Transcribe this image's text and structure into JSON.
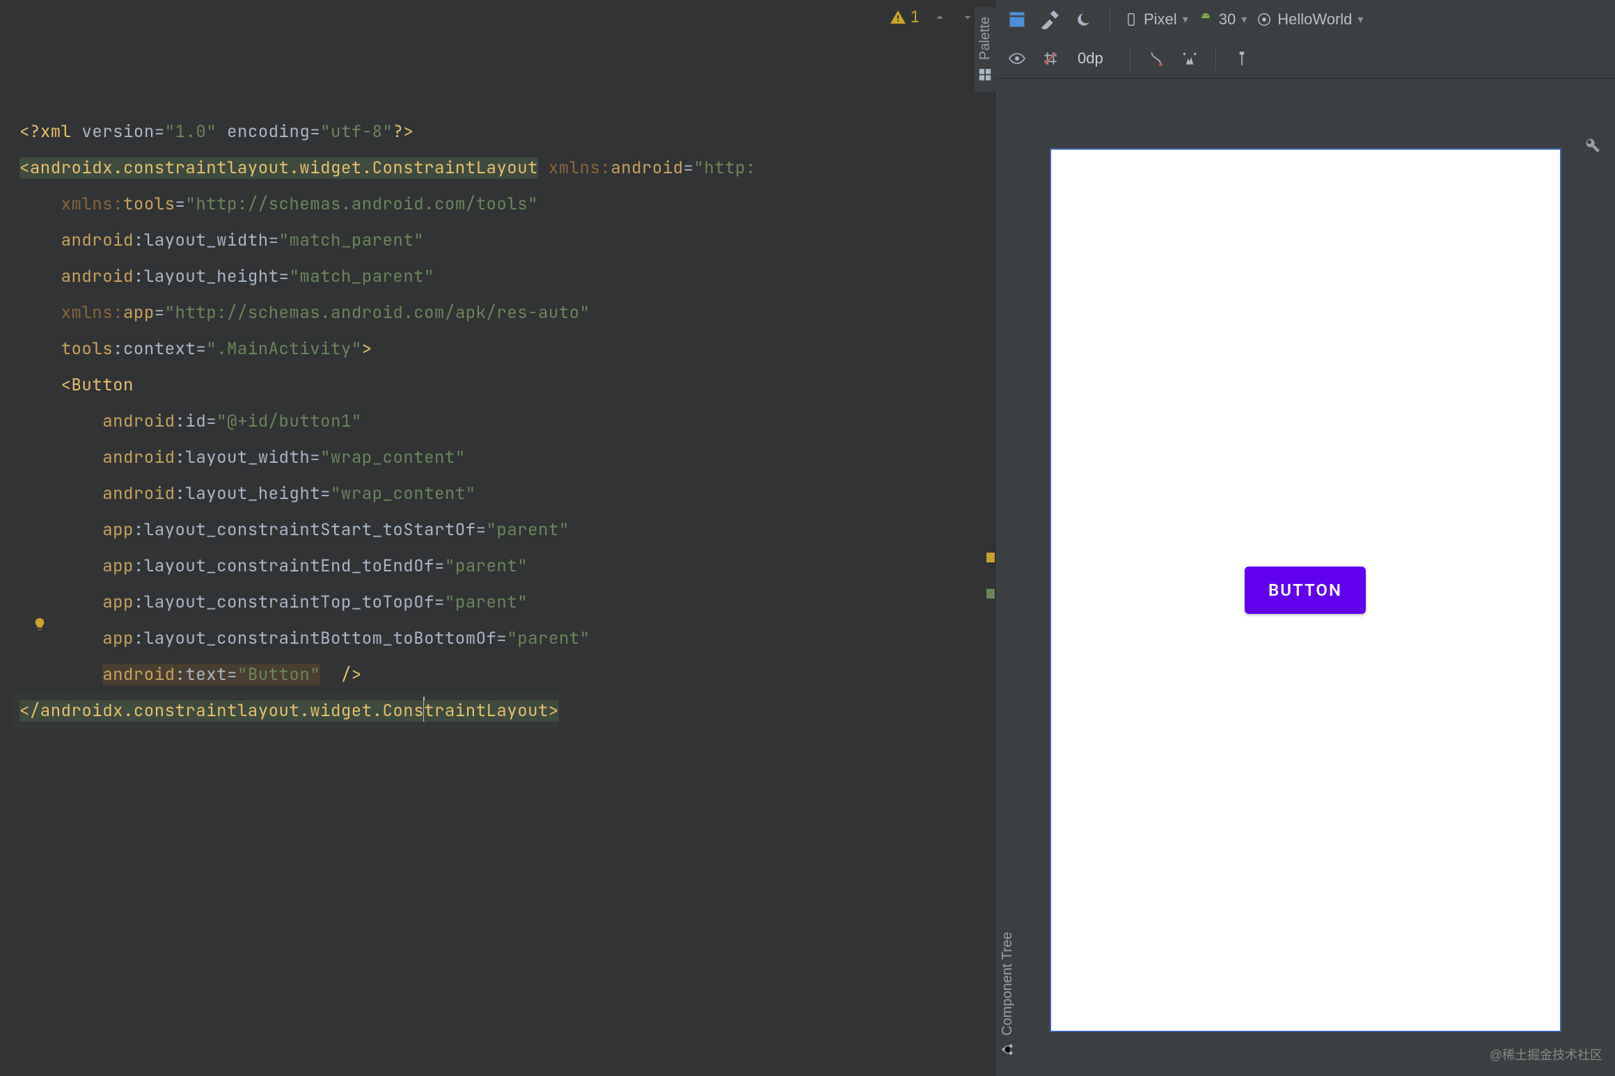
{
  "editor": {
    "warning_count": "1",
    "lines": [
      [
        {
          "cls": "pi",
          "t": "<?"
        },
        {
          "cls": "pi",
          "t": "xml "
        },
        {
          "cls": "light",
          "t": "version"
        },
        {
          "cls": "eq",
          "t": "="
        },
        {
          "cls": "str",
          "t": "\"1.0\" "
        },
        {
          "cls": "light",
          "t": "encoding"
        },
        {
          "cls": "eq",
          "t": "="
        },
        {
          "cls": "str",
          "t": "\"utf-8\""
        },
        {
          "cls": "pi",
          "t": "?>"
        }
      ],
      [
        {
          "cls": "tag sel-tag",
          "t": "<androidx.constraintlayout.widget.ConstraintLayout"
        },
        {
          "cls": "light",
          "t": " "
        },
        {
          "cls": "attrns",
          "t": "xmlns:"
        },
        {
          "cls": "attrns2",
          "t": "android"
        },
        {
          "cls": "eq",
          "t": "="
        },
        {
          "cls": "str",
          "t": "\"http:"
        }
      ],
      [
        {
          "cls": "light",
          "t": "    "
        },
        {
          "cls": "attrns",
          "t": "xmlns:"
        },
        {
          "cls": "attrns2",
          "t": "tools"
        },
        {
          "cls": "eq",
          "t": "="
        },
        {
          "cls": "str",
          "t": "\"http://schemas.android.com/tools\""
        }
      ],
      [
        {
          "cls": "light",
          "t": "    "
        },
        {
          "cls": "attrns2",
          "t": "android"
        },
        {
          "cls": "light",
          "t": ":"
        },
        {
          "cls": "light",
          "t": "layout_width"
        },
        {
          "cls": "eq",
          "t": "="
        },
        {
          "cls": "str",
          "t": "\"match_parent\""
        }
      ],
      [
        {
          "cls": "light",
          "t": "    "
        },
        {
          "cls": "attrns2",
          "t": "android"
        },
        {
          "cls": "light",
          "t": ":"
        },
        {
          "cls": "light",
          "t": "layout_height"
        },
        {
          "cls": "eq",
          "t": "="
        },
        {
          "cls": "str",
          "t": "\"match_parent\""
        }
      ],
      [
        {
          "cls": "light",
          "t": "    "
        },
        {
          "cls": "attrns",
          "t": "xmlns:"
        },
        {
          "cls": "attrns2",
          "t": "app"
        },
        {
          "cls": "eq",
          "t": "="
        },
        {
          "cls": "str",
          "t": "\"http://schemas.android.com/apk/res-auto\""
        }
      ],
      [
        {
          "cls": "light",
          "t": "    "
        },
        {
          "cls": "attrns2",
          "t": "tools"
        },
        {
          "cls": "light",
          "t": ":"
        },
        {
          "cls": "light",
          "t": "context"
        },
        {
          "cls": "eq",
          "t": "="
        },
        {
          "cls": "str",
          "t": "\".MainActivity\""
        },
        {
          "cls": "tag",
          "t": ">"
        }
      ],
      [
        {
          "cls": "light",
          "t": "    "
        },
        {
          "cls": "tag",
          "t": "<Button"
        }
      ],
      [
        {
          "cls": "light",
          "t": "        "
        },
        {
          "cls": "attrns2",
          "t": "android"
        },
        {
          "cls": "light",
          "t": ":"
        },
        {
          "cls": "light",
          "t": "id"
        },
        {
          "cls": "eq",
          "t": "="
        },
        {
          "cls": "str",
          "t": "\"@+id/button1\""
        }
      ],
      [
        {
          "cls": "light",
          "t": "        "
        },
        {
          "cls": "attrns2",
          "t": "android"
        },
        {
          "cls": "light",
          "t": ":"
        },
        {
          "cls": "light",
          "t": "layout_width"
        },
        {
          "cls": "eq",
          "t": "="
        },
        {
          "cls": "str",
          "t": "\"wrap_content\""
        }
      ],
      [
        {
          "cls": "light",
          "t": "        "
        },
        {
          "cls": "attrns2",
          "t": "android"
        },
        {
          "cls": "light",
          "t": ":"
        },
        {
          "cls": "light",
          "t": "layout_height"
        },
        {
          "cls": "eq",
          "t": "="
        },
        {
          "cls": "str",
          "t": "\"wrap_content\""
        }
      ],
      [
        {
          "cls": "light",
          "t": "        "
        },
        {
          "cls": "attrns2",
          "t": "app"
        },
        {
          "cls": "light",
          "t": ":"
        },
        {
          "cls": "light",
          "t": "layout_constraintStart_toStartOf"
        },
        {
          "cls": "eq",
          "t": "="
        },
        {
          "cls": "str",
          "t": "\"parent\""
        }
      ],
      [
        {
          "cls": "light",
          "t": "        "
        },
        {
          "cls": "attrns2",
          "t": "app"
        },
        {
          "cls": "light",
          "t": ":"
        },
        {
          "cls": "light",
          "t": "layout_constraintEnd_toEndOf"
        },
        {
          "cls": "eq",
          "t": "="
        },
        {
          "cls": "str",
          "t": "\"parent\""
        }
      ],
      [
        {
          "cls": "light",
          "t": "        "
        },
        {
          "cls": "attrns2",
          "t": "app"
        },
        {
          "cls": "light",
          "t": ":"
        },
        {
          "cls": "light",
          "t": "layout_constraintTop_toTopOf"
        },
        {
          "cls": "eq",
          "t": "="
        },
        {
          "cls": "str",
          "t": "\"parent\""
        }
      ],
      [
        {
          "cls": "light",
          "t": "        "
        },
        {
          "cls": "attrns2",
          "t": "app"
        },
        {
          "cls": "light",
          "t": ":"
        },
        {
          "cls": "light",
          "t": "layout_constraintBottom_toBottomOf"
        },
        {
          "cls": "eq",
          "t": "="
        },
        {
          "cls": "str",
          "t": "\"parent\""
        }
      ],
      [
        {
          "cls": "light",
          "t": "        "
        },
        {
          "cls": "attrns2 hl-attr",
          "t": "android"
        },
        {
          "cls": "light hl-attr",
          "t": ":"
        },
        {
          "cls": "light hl-attr",
          "t": "text"
        },
        {
          "cls": "eq hl-attr",
          "t": "="
        },
        {
          "cls": "str hl-attr",
          "t": "\"Button\""
        },
        {
          "cls": "light",
          "t": "  "
        },
        {
          "cls": "tag",
          "t": "/>"
        }
      ],
      [
        {
          "cls": "tag sel-tag",
          "t": "</androidx.constraintlayout.widget.Cons"
        },
        {
          "cls": "caret",
          "t": ""
        },
        {
          "cls": "tag sel-tag",
          "t": "traintLayout>"
        }
      ]
    ]
  },
  "toolbar": {
    "device": "Pixel",
    "api": "30",
    "theme": "HelloWorld",
    "margin": "0dp"
  },
  "preview": {
    "button_text": "BUTTON"
  },
  "side": {
    "palette": "Palette",
    "component_tree": "Component Tree"
  },
  "watermark": "@稀土掘金技术社区"
}
